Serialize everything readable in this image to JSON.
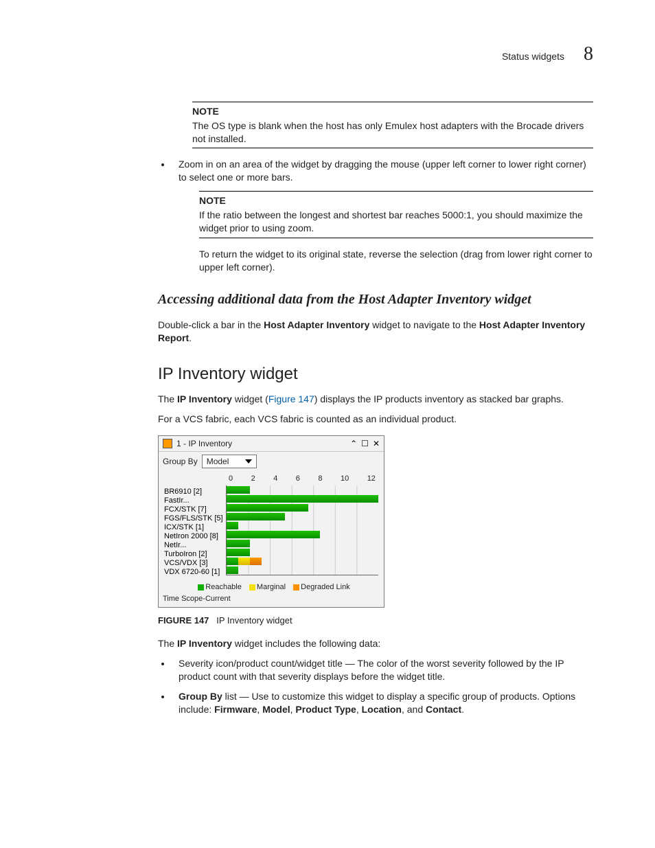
{
  "header": {
    "section": "Status widgets",
    "chapter": "8"
  },
  "notes": {
    "label": "NOTE",
    "os_blank": "The OS type is blank when the host has only Emulex host adapters with the Brocade drivers not installed.",
    "ratio": "If the ratio between the longest and shortest bar reaches 5000:1, you should maximize the widget prior to using zoom."
  },
  "bullets": {
    "zoom": "Zoom in on an area of the widget by dragging the mouse (upper left corner to lower right corner) to select one or more bars."
  },
  "para": {
    "return_state": "To return the widget to its original state, reverse the selection (drag from lower right corner to upper left corner)."
  },
  "headings": {
    "accessing": "Accessing additional data from the Host Adapter Inventory widget",
    "ip_inventory": "IP Inventory widget"
  },
  "accessing_para": {
    "p1a": "Double-click a bar in the ",
    "p1b": "Host Adapter Inventory",
    "p1c": " widget to navigate to the ",
    "p1d": "Host Adapter Inventory Report",
    "p1e": "."
  },
  "ip_intro": {
    "a": "The ",
    "b": "IP Inventory",
    "c": " widget (",
    "link": "Figure 147",
    "d": ") displays the IP products inventory as stacked bar graphs.",
    "vcs": "For a VCS fabric, each VCS fabric is counted as an individual product."
  },
  "widget": {
    "title_count": "1",
    "title_text": "IP Inventory",
    "group_by_label": "Group By",
    "group_by_value": "Model",
    "icons": {
      "collapse": "⌃",
      "maximize": "☐",
      "close": "✕"
    },
    "legend": {
      "reachable": "Reachable",
      "marginal": "Marginal",
      "degraded": "Degraded Link"
    },
    "scope": "Time Scope-Current"
  },
  "chart_data": {
    "type": "bar",
    "orientation": "horizontal",
    "xlabel": "",
    "ylabel": "",
    "xlim": [
      0,
      13
    ],
    "xticks": [
      0,
      2,
      4,
      6,
      8,
      10,
      12
    ],
    "categories": [
      "BR6910 [2]",
      "FastIr...",
      "FCX/STK [7]",
      "FGS/FLS/STK [5]",
      "ICX/STK [1]",
      "NetIron 2000 [8]",
      "NetIr...",
      "TurboIron [2]",
      "VCS/VDX [3]",
      "VDX 6720-60 [1]"
    ],
    "series": [
      {
        "name": "Reachable",
        "color": "#12b000",
        "values": [
          2,
          13,
          7,
          5,
          1,
          8,
          2,
          2,
          1,
          1
        ]
      },
      {
        "name": "Marginal",
        "color": "#f5e100",
        "values": [
          0,
          0,
          0,
          0,
          0,
          0,
          0,
          0,
          1,
          0
        ]
      },
      {
        "name": "Degraded Link",
        "color": "#ff9000",
        "values": [
          0,
          0,
          0,
          0,
          0,
          0,
          0,
          0,
          1,
          0
        ]
      }
    ]
  },
  "figure": {
    "label": "FIGURE 147",
    "caption": "IP Inventory widget"
  },
  "after_fig": {
    "a": "The ",
    "b": "IP Inventory",
    "c": " widget includes the following data:"
  },
  "data_bullets": {
    "severity": "Severity icon/product count/widget title — The color of the worst severity followed by the IP product count with that severity displays before the widget title.",
    "groupby_label": "Group By",
    "groupby_rest": " list — Use to customize this widget to display a specific group of products. Options include: ",
    "opts": {
      "a": "Firmware",
      "b": "Model",
      "c": "Product Type",
      "d": "Location",
      "e": "Contact"
    },
    "sep": ", ",
    "and": ", and ",
    "period": "."
  }
}
